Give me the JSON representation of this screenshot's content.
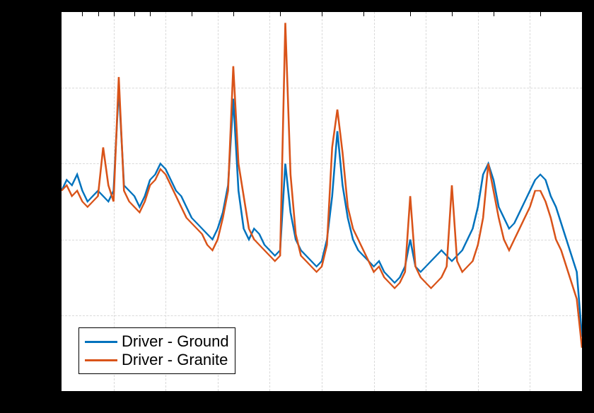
{
  "chart_data": {
    "type": "line",
    "x": [
      0,
      1,
      2,
      3,
      4,
      5,
      6,
      7,
      8,
      9,
      10,
      11,
      12,
      13,
      14,
      15,
      16,
      17,
      18,
      19,
      20,
      21,
      22,
      23,
      24,
      25,
      26,
      27,
      28,
      29,
      30,
      31,
      32,
      33,
      34,
      35,
      36,
      37,
      38,
      39,
      40,
      41,
      42,
      43,
      44,
      45,
      46,
      47,
      48,
      49,
      50,
      51,
      52,
      53,
      54,
      55,
      56,
      57,
      58,
      59,
      60,
      61,
      62,
      63,
      64,
      65,
      66,
      67,
      68,
      69,
      70,
      71,
      72,
      73,
      74,
      75,
      76,
      77,
      78,
      79,
      80,
      81,
      82,
      83,
      84,
      85,
      86,
      87,
      88,
      89,
      90,
      91,
      92,
      93,
      94,
      95,
      96,
      97,
      98,
      99,
      100
    ],
    "series": [
      {
        "name": "Driver - Ground",
        "color": "#0072bd",
        "values": [
          47,
          49,
          48,
          50,
          47,
          45,
          46,
          47,
          46,
          45,
          47,
          66,
          48,
          47,
          46,
          44,
          46,
          49,
          50,
          52,
          51,
          49,
          47,
          46,
          44,
          42,
          41,
          40,
          39,
          38,
          40,
          43,
          48,
          64,
          47,
          40,
          38,
          40,
          39,
          37,
          36,
          35,
          36,
          52,
          43,
          38,
          36,
          35,
          34,
          33,
          34,
          38,
          46,
          58,
          48,
          42,
          38,
          36,
          35,
          34,
          33,
          34,
          32,
          31,
          30,
          31,
          33,
          38,
          33,
          32,
          33,
          34,
          35,
          36,
          35,
          34,
          35,
          36,
          38,
          40,
          44,
          50,
          52,
          49,
          44,
          42,
          40,
          41,
          43,
          45,
          47,
          49,
          50,
          49,
          46,
          44,
          41,
          38,
          35,
          32,
          20
        ]
      },
      {
        "name": "Driver - Granite",
        "color": "#d95319",
        "values": [
          47,
          48,
          46,
          47,
          45,
          44,
          45,
          46,
          55,
          48,
          45,
          68,
          47,
          45,
          44,
          43,
          45,
          48,
          49,
          51,
          50,
          48,
          46,
          44,
          42,
          41,
          40,
          39,
          37,
          36,
          38,
          42,
          47,
          70,
          52,
          46,
          40,
          38,
          37,
          36,
          35,
          34,
          35,
          78,
          50,
          39,
          35,
          34,
          33,
          32,
          33,
          37,
          55,
          62,
          54,
          44,
          40,
          38,
          36,
          34,
          32,
          33,
          31,
          30,
          29,
          30,
          32,
          46,
          33,
          31,
          30,
          29,
          30,
          31,
          33,
          48,
          34,
          32,
          33,
          34,
          37,
          42,
          52,
          47,
          42,
          38,
          36,
          38,
          40,
          42,
          44,
          47,
          47,
          45,
          42,
          38,
          36,
          33,
          30,
          27,
          18
        ]
      }
    ],
    "title": "",
    "xlabel": "",
    "ylabel": "",
    "xlim": [
      0,
      100
    ],
    "ylim": [
      10,
      80
    ],
    "grid": true,
    "legend_position": "bottom-left"
  },
  "legend": {
    "items": [
      {
        "label": "Driver - Ground"
      },
      {
        "label": "Driver - Granite"
      }
    ]
  }
}
